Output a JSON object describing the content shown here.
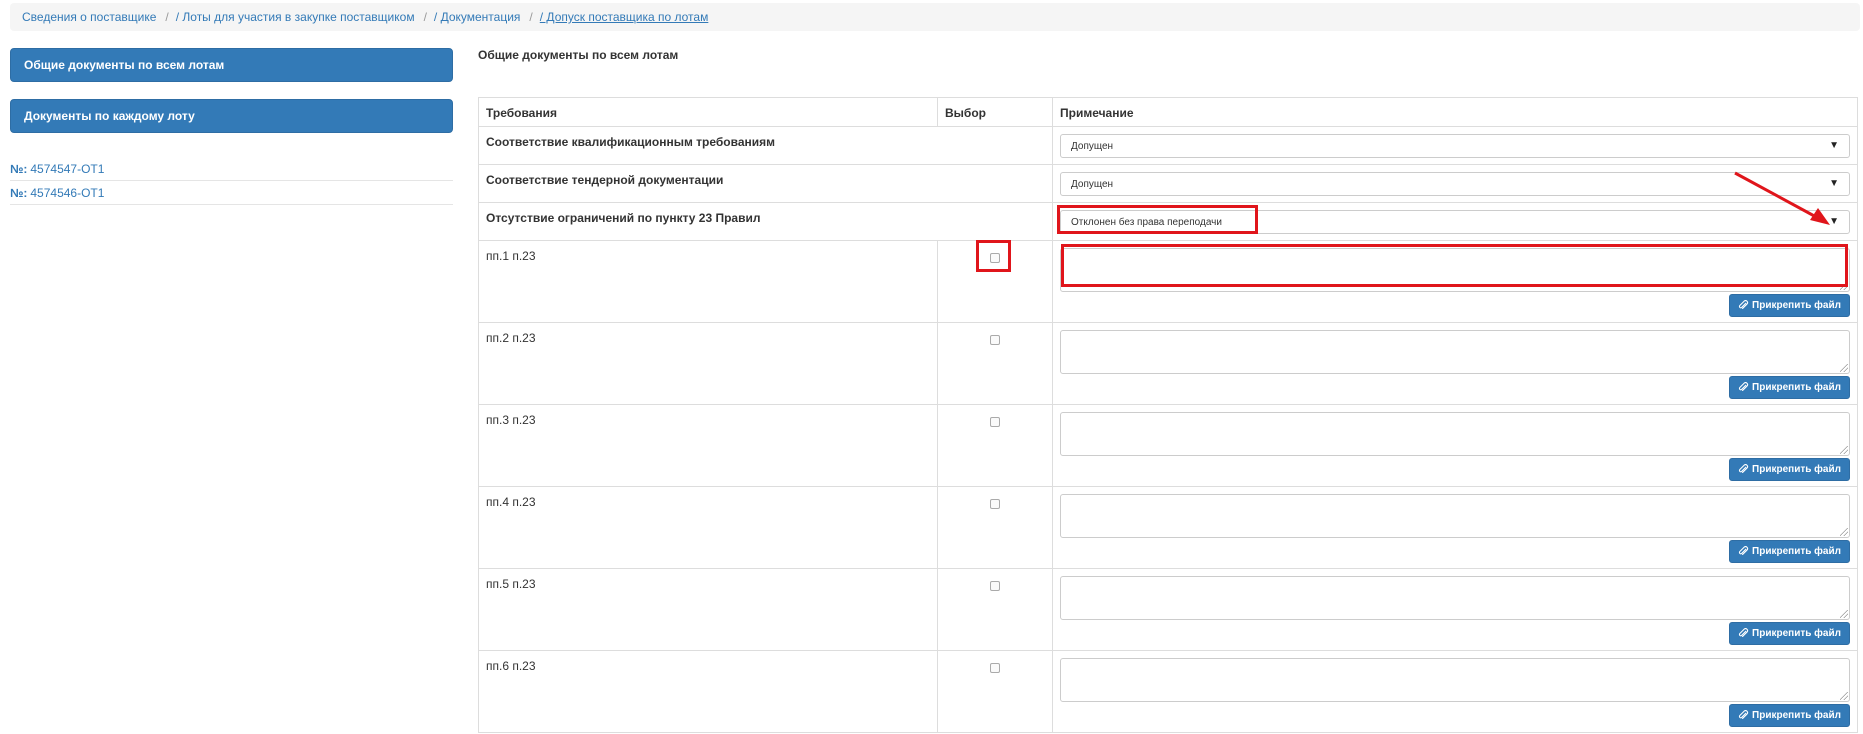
{
  "breadcrumb": {
    "items": [
      {
        "label": "Сведения о поставщике"
      },
      {
        "label": "/ Лоты для участия в закупке поставщиком"
      },
      {
        "label": "/ Документация"
      },
      {
        "label": "/ Допуск поставщика по лотам"
      }
    ],
    "separator": "/"
  },
  "sidebar": {
    "buttons": [
      {
        "label": "Общие документы по всем лотам"
      },
      {
        "label": "Документы по каждому лоту"
      }
    ],
    "lots": [
      {
        "prefix": "№:",
        "number": "4574547-ОТ1"
      },
      {
        "prefix": "№:",
        "number": "4574546-ОТ1"
      }
    ]
  },
  "main": {
    "title": "Общие документы по всем лотам",
    "columns": {
      "requirements": "Требования",
      "choice": "Выбор",
      "note": "Примечание"
    },
    "requirements": [
      {
        "label": "Соответствие квалификационным требованиям",
        "status": "Допущен"
      },
      {
        "label": "Соответствие тендерной документации",
        "status": "Допущен"
      },
      {
        "label": "Отсутствие ограничений по пункту 23 Правил",
        "status": "Отклонен без права переподачи"
      }
    ],
    "sub_items": [
      {
        "label": "пп.1 п.23",
        "checked": false,
        "note": ""
      },
      {
        "label": "пп.2 п.23",
        "checked": false,
        "note": ""
      },
      {
        "label": "пп.3 п.23",
        "checked": false,
        "note": ""
      },
      {
        "label": "пп.4 п.23",
        "checked": false,
        "note": ""
      },
      {
        "label": "пп.5 п.23",
        "checked": false,
        "note": ""
      },
      {
        "label": "пп.6 п.23",
        "checked": false,
        "note": ""
      }
    ],
    "attach_label": "Прикрепить файл",
    "select_arrow": "▼"
  },
  "colors": {
    "accent": "#337ab7",
    "highlight": "#e0151b"
  }
}
